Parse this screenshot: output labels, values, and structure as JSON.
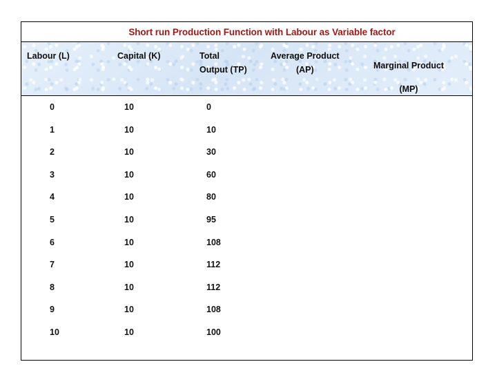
{
  "table": {
    "title": "Short run Production Function with Labour as Variable factor",
    "title_color": "#9c1a16",
    "header_bg_color": "#dde9f8",
    "border_color": "#000000",
    "columns": [
      {
        "key": "labour",
        "label": "Labour (L)",
        "label_line2": ""
      },
      {
        "key": "capital",
        "label": "Capital (K)",
        "label_line2": ""
      },
      {
        "key": "tp",
        "label": "Total",
        "label_line2": "Output (TP)"
      },
      {
        "key": "ap",
        "label": "Average Product",
        "label_line2": "(AP)"
      },
      {
        "key": "mp",
        "label": "Marginal Product",
        "label_line2": "(MP)"
      }
    ],
    "rows": [
      {
        "labour": "0",
        "capital": "10",
        "tp": "0",
        "ap": "",
        "mp": ""
      },
      {
        "labour": "1",
        "capital": "10",
        "tp": "10",
        "ap": "",
        "mp": ""
      },
      {
        "labour": "2",
        "capital": "10",
        "tp": "30",
        "ap": "",
        "mp": ""
      },
      {
        "labour": "3",
        "capital": "10",
        "tp": "60",
        "ap": "",
        "mp": ""
      },
      {
        "labour": "4",
        "capital": "10",
        "tp": "80",
        "ap": "",
        "mp": ""
      },
      {
        "labour": "5",
        "capital": "10",
        "tp": "95",
        "ap": "",
        "mp": ""
      },
      {
        "labour": "6",
        "capital": "10",
        "tp": "108",
        "ap": "",
        "mp": ""
      },
      {
        "labour": "7",
        "capital": "10",
        "tp": "112",
        "ap": "",
        "mp": ""
      },
      {
        "labour": "8",
        "capital": "10",
        "tp": "112",
        "ap": "",
        "mp": ""
      },
      {
        "labour": "9",
        "capital": "10",
        "tp": "108",
        "ap": "",
        "mp": ""
      },
      {
        "labour": "10",
        "capital": "10",
        "tp": "100",
        "ap": "",
        "mp": ""
      }
    ]
  }
}
